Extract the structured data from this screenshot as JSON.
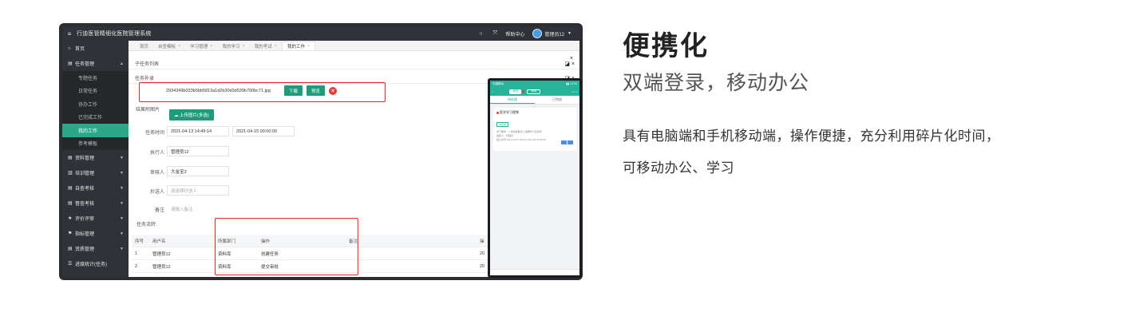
{
  "app": {
    "title": "行迪医管精细化医院管理系统",
    "help": "帮助中心",
    "user": "管理员12"
  },
  "sidebar": {
    "items": [
      {
        "icon": "⌂",
        "label": "首页"
      },
      {
        "icon": "▤",
        "label": "任务管理",
        "arrow": "▲"
      },
      {
        "sub": "专题任务"
      },
      {
        "sub": "日常任务"
      },
      {
        "sub": "协办工作"
      },
      {
        "sub": "已完成工作"
      },
      {
        "sub": "我的工作",
        "active": true
      },
      {
        "sub": "参考模板"
      },
      {
        "icon": "▤",
        "label": "资料管理",
        "arrow": "▼"
      },
      {
        "icon": "▥",
        "label": "培训管理",
        "arrow": "▼"
      },
      {
        "icon": "▤",
        "label": "自查考核",
        "arrow": "▼"
      },
      {
        "icon": "▤",
        "label": "督查考核",
        "arrow": "▼"
      },
      {
        "icon": "★",
        "label": "评价评审",
        "arrow": "▼"
      },
      {
        "icon": "⚑",
        "label": "指标管理",
        "arrow": "▼"
      },
      {
        "icon": "▤",
        "label": "资质管理",
        "arrow": "▼"
      },
      {
        "icon": "☰",
        "label": "进度统计(任务)"
      }
    ]
  },
  "tabs": [
    {
      "label": "首页"
    },
    {
      "label": "自查模板",
      "close": "×"
    },
    {
      "label": "学习管理",
      "close": "×"
    },
    {
      "label": "我的学习",
      "close": "×"
    },
    {
      "label": "我的考试",
      "close": "×"
    },
    {
      "label": "我的工作",
      "close": "×",
      "active": true
    }
  ],
  "panels": {
    "subtask_list": "子任务列表",
    "task_supplement": "任务补录",
    "tools": "◪ ×",
    "close": "×"
  },
  "file": {
    "name": "2934349b033b5bb5813a1d2b30d3d539b700bc71.jpg",
    "download": "下载",
    "preview": "预览",
    "delete": "✕"
  },
  "form": {
    "attach_label": "结果附图片",
    "upload": "☁ 上传图片(多选)",
    "time_label": "任务时间",
    "start_time": "2021-04-13 14:49:14",
    "end_time": "2021-04-15 00:00:00",
    "executor_label": "执行人",
    "executor": "管理员12",
    "reviewer_label": "审核人",
    "reviewer": "大金宝3",
    "cc_label": "抄送人",
    "cc_placeholder": "请选择抄送人",
    "note_label": "备注",
    "note_placeholder": "请输入备注",
    "flow_label": "任务流转:"
  },
  "table": {
    "headers": [
      "序号",
      "用户名",
      "所属部门",
      "操作",
      "备注",
      "操"
    ],
    "rows": [
      [
        "1",
        "管理员12",
        "资料库",
        "创建任务",
        "",
        "20"
      ],
      [
        "2",
        "管理员12",
        "资料库",
        "提交审批",
        "",
        "20"
      ]
    ]
  },
  "phone": {
    "status_left": "中国移动",
    "status_right": "▮▮ 12:00",
    "nav_back": "‹",
    "pill1": "我的",
    "pill2": "审批",
    "more": "• • •",
    "tab1": "待处理",
    "tab2": "已完成",
    "card_title": "医学学习视频",
    "card_badge": "未完成",
    "card_line1": "学习要求：1.视频需看完 2.需要学习后测评",
    "card_line2": "发起人：管理员",
    "card_line3": "起止时间 2021-04-17 00:00~2021-04-20 00:00"
  },
  "headline": "便携化",
  "subline": "双端登录，移动办公",
  "desc1": "具有电脑端和手机移动端，操作便捷，充分利用碎片化时间，",
  "desc2": "可移动办公、学习",
  "colors": {
    "accent": "#1f9a7a",
    "sidebar_bg": "#2f3237",
    "highlight_box": "#e02222"
  }
}
